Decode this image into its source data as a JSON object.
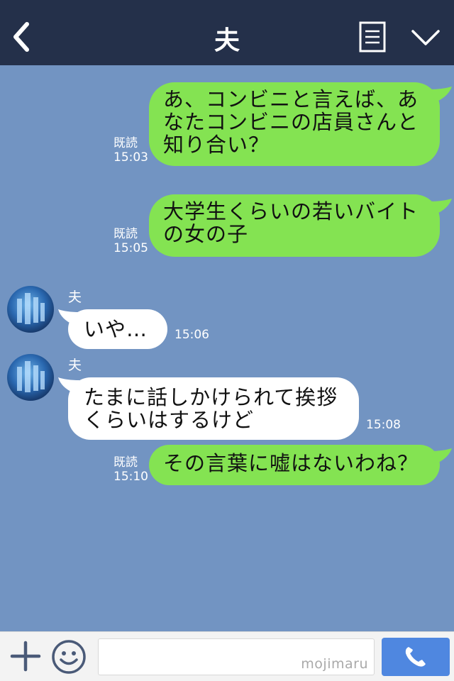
{
  "header": {
    "title": "夫",
    "back_icon": "chevron-left-icon",
    "notes_icon": "notes-icon",
    "menu_icon": "chevron-down-icon"
  },
  "colors": {
    "header_bg": "#24304a",
    "chat_bg": "#7294c2",
    "outgoing_bubble": "#84e352",
    "incoming_bubble": "#ffffff",
    "call_button": "#4f87e0"
  },
  "messages": [
    {
      "direction": "out",
      "text": "あ、コンビニと言えば、あ\nなたコンビニの店員さんと\n知り合い？",
      "read": "既読",
      "time": "15:03"
    },
    {
      "direction": "out",
      "text": "大学生くらいの若いバイト\nの女の子",
      "read": "既読",
      "time": "15:05"
    },
    {
      "direction": "in",
      "sender": "夫",
      "text": "いや…",
      "time": "15:06"
    },
    {
      "direction": "in",
      "sender": "夫",
      "text": "たまに話しかけられて挨拶\nくらいはするけど",
      "time": "15:08"
    },
    {
      "direction": "out",
      "text": "その言葉に嘘はないわね？",
      "read": "既読",
      "time": "15:10"
    }
  ],
  "bottom_bar": {
    "add_icon": "plus-icon",
    "sticker_icon": "smile-icon",
    "input_value": "",
    "watermark": "mojimaru",
    "call_icon": "phone-icon"
  }
}
